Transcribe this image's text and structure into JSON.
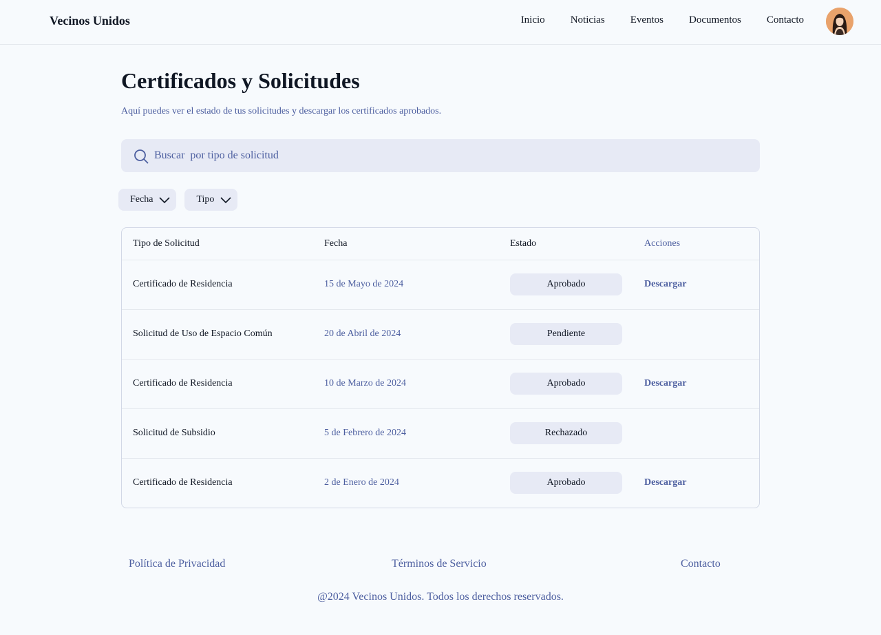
{
  "header": {
    "brand": "Vecinos Unidos",
    "nav": [
      "Inicio",
      "Noticias",
      "Eventos",
      "Documentos",
      "Contacto"
    ]
  },
  "main": {
    "title": "Certificados y Solicitudes",
    "subtitle": "Aquí puedes ver el estado de tus solicitudes y descargar los certificados aprobados.",
    "search_placeholder": "Buscar  por tipo de solicitud",
    "filters": [
      "Fecha",
      "Tipo"
    ]
  },
  "table": {
    "headers": [
      "Tipo de Solicitud",
      "Fecha",
      "Estado",
      "Acciones"
    ],
    "rows": [
      {
        "type": "Certificado de Residencia",
        "date": "15 de Mayo de 2024",
        "status": "Aprobado",
        "action": "Descargar"
      },
      {
        "type": "Solicitud de Uso de Espacio Común",
        "date": "20 de Abril de 2024",
        "status": "Pendiente",
        "action": ""
      },
      {
        "type": "Certificado de Residencia",
        "date": "10 de Marzo de 2024",
        "status": "Aprobado",
        "action": "Descargar"
      },
      {
        "type": "Solicitud de Subsidio",
        "date": "5 de Febrero de 2024",
        "status": "Rechazado",
        "action": ""
      },
      {
        "type": "Certificado de Residencia",
        "date": "2 de Enero de 2024",
        "status": "Aprobado",
        "action": "Descargar"
      }
    ]
  },
  "footer": {
    "links": [
      "Política de Privacidad",
      "Términos de Servicio",
      "Contacto"
    ],
    "copyright": "@2024 Vecinos Unidos. Todos los derechos reservados."
  },
  "colors": {
    "accent": "#4d5fa0",
    "chip_bg": "#e7eaf5",
    "page_bg": "#f7fafd"
  },
  "icons": {
    "search": "search-icon",
    "chevron": "chevron-down-icon",
    "avatar": "user-avatar"
  }
}
